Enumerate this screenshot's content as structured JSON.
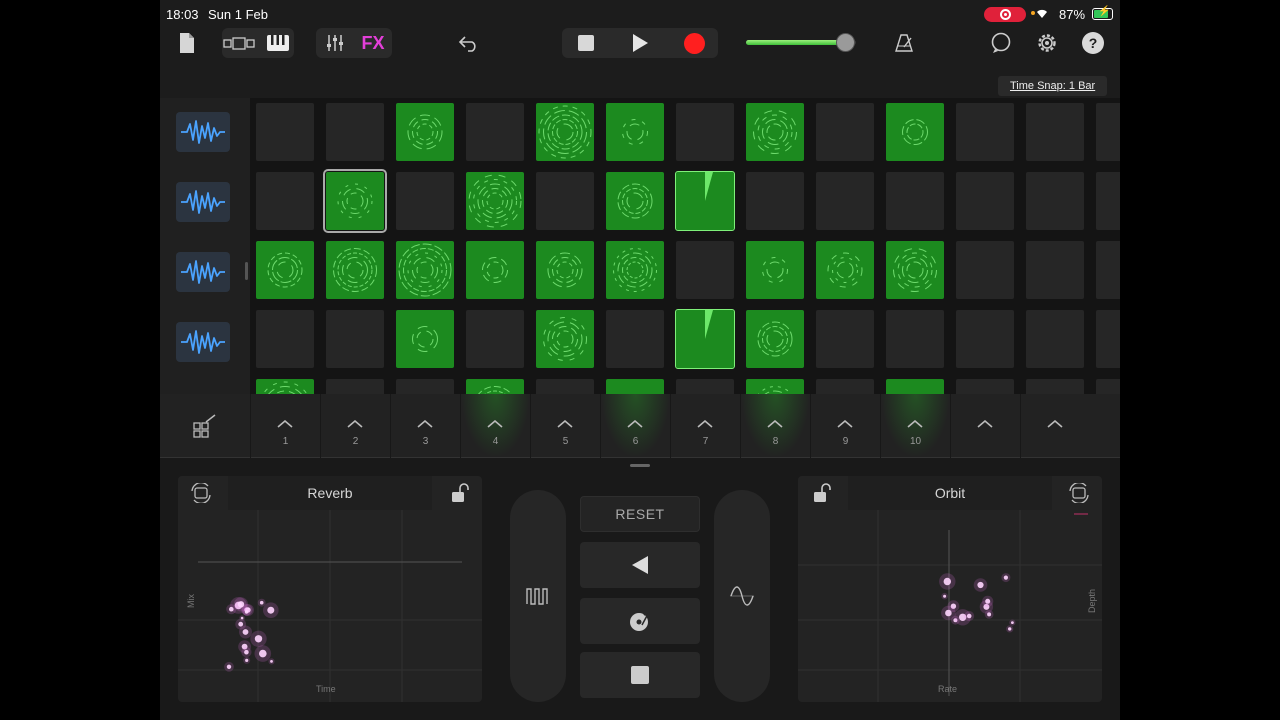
{
  "status_bar": {
    "time": "18:03",
    "date": "Sun 1 Feb",
    "battery_percent": "87%",
    "battery_level": 0.87,
    "recording_indicator_color": "#e0213a"
  },
  "toolbar": {
    "fx_label": "FX",
    "icons": [
      "document-icon",
      "view-toggle-icon",
      "keyboard-icon",
      "mixer-icon",
      "undo-icon",
      "stop-icon",
      "play-icon",
      "record-icon",
      "metronome-icon",
      "loop-browser-icon",
      "settings-icon",
      "help-icon"
    ],
    "master_volume_level": 0.9,
    "help_label": "?"
  },
  "time_snap": "Time Snap: 1 Bar",
  "tracks": [
    {
      "icon": "waveform-icon"
    },
    {
      "icon": "waveform-icon"
    },
    {
      "icon": "waveform-icon"
    },
    {
      "icon": "waveform-icon"
    }
  ],
  "grid": {
    "rows": [
      [
        0,
        0,
        1,
        0,
        1,
        1,
        0,
        1,
        0,
        1,
        0,
        0,
        0
      ],
      [
        0,
        2,
        0,
        1,
        0,
        1,
        3,
        0,
        0,
        0,
        0,
        0,
        0
      ],
      [
        1,
        1,
        1,
        1,
        1,
        1,
        0,
        1,
        1,
        1,
        0,
        0,
        0
      ],
      [
        0,
        0,
        1,
        0,
        1,
        0,
        3,
        1,
        0,
        0,
        0,
        0,
        0
      ],
      [
        1,
        0,
        0,
        1,
        0,
        1,
        0,
        1,
        0,
        1,
        0,
        0,
        0
      ]
    ],
    "legend": "0 empty, 1 cell, 2 selected cell, 3 queued/playing cell",
    "active_color": "#1c8a1f"
  },
  "scenes": {
    "labels": [
      "1",
      "2",
      "3",
      "4",
      "5",
      "6",
      "7",
      "8",
      "9",
      "10",
      "",
      ""
    ],
    "glowing": [
      4,
      6,
      8,
      10
    ]
  },
  "fx": {
    "left": {
      "title": "Reverb",
      "x_label": "Time",
      "y_label": "Mix",
      "lock_state": "unlocked"
    },
    "right": {
      "title": "Orbit",
      "x_label": "Rate",
      "y_label": "Depth",
      "lock_state": "unlocked"
    },
    "reset_label": "RESET",
    "buttons": [
      "reverse-icon",
      "scratch-icon",
      "stop-icon"
    ],
    "left_pill_icon": "gate-icon",
    "right_pill_icon": "wave-icon",
    "particle_color": "#f07af0"
  }
}
